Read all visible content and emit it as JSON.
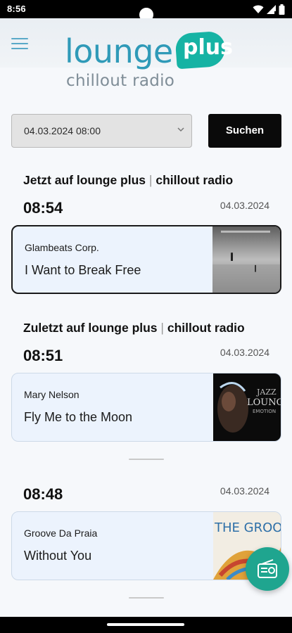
{
  "status_bar": {
    "time": "8:56"
  },
  "header": {
    "logo_main": "lounge",
    "logo_badge": "plus",
    "logo_sub": "chillout radio"
  },
  "search": {
    "datetime_value": "04.03.2024 08:00",
    "button_label": "Suchen"
  },
  "now_playing": {
    "title_prefix": "Jetzt auf lounge plus",
    "title_sep": "|",
    "title_suffix": "chillout radio",
    "time": "08:54",
    "date": "04.03.2024",
    "artist": "Glambeats Corp.",
    "song": "I Want to Break Free"
  },
  "recent": {
    "title_prefix": "Zuletzt auf lounge plus",
    "title_sep": "|",
    "title_suffix": "chillout radio",
    "items": [
      {
        "time": "08:51",
        "date": "04.03.2024",
        "artist": "Mary Nelson",
        "song": "Fly Me to the Moon"
      },
      {
        "time": "08:48",
        "date": "04.03.2024",
        "artist": "Groove Da Praia",
        "song": "Without You"
      }
    ]
  },
  "covers": {
    "cover_2_text_1": "JAZZ",
    "cover_2_text_2": "LOUNGE",
    "cover_2_text_3": "EMOTION",
    "cover_3_text": "THE GROO"
  },
  "colors": {
    "accent_teal": "#1fa58f",
    "logo_blue": "#2f9ab8",
    "card_bg": "#ecf3fd"
  }
}
